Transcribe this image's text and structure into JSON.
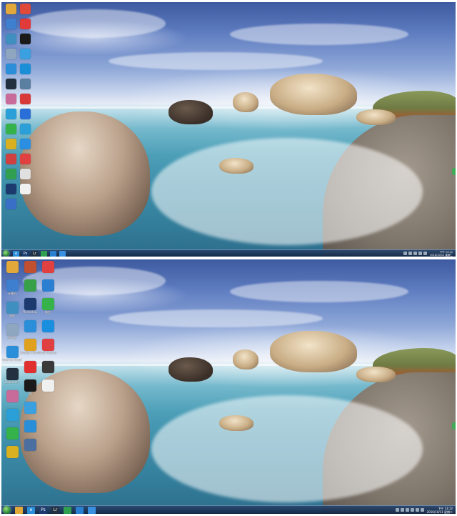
{
  "screens": {
    "top": {
      "icons_col1": [
        {
          "label": "",
          "icon": "folder-icon",
          "color": "#e2a83a"
        },
        {
          "label": "",
          "icon": "computer-icon",
          "color": "#3f7fd0"
        },
        {
          "label": "",
          "icon": "network-icon",
          "color": "#3f8fc0"
        },
        {
          "label": "",
          "icon": "recycle-bin-icon",
          "color": "#8fa6c0"
        },
        {
          "label": "",
          "icon": "ie-icon",
          "color": "#2a8fd8"
        },
        {
          "label": "",
          "icon": "lightroom-icon",
          "color": "#233040"
        },
        {
          "label": "",
          "icon": "app-icon",
          "color": "#c86a9a"
        },
        {
          "label": "",
          "icon": "cloud-icon",
          "color": "#2a9fd8"
        },
        {
          "label": "",
          "icon": "wechat-icon",
          "color": "#35b34a"
        },
        {
          "label": "",
          "icon": "app-icon",
          "color": "#d9b020"
        },
        {
          "label": "",
          "icon": "app-icon",
          "color": "#d04040"
        },
        {
          "label": "",
          "icon": "app-icon",
          "color": "#30a050"
        },
        {
          "label": "",
          "icon": "photoshop-icon",
          "color": "#1c3a6e"
        },
        {
          "label": "",
          "icon": "app-icon",
          "color": "#3a6fc8"
        }
      ],
      "icons_col2": [
        {
          "label": "",
          "icon": "chrome-icon",
          "color": "#e04a3a"
        },
        {
          "label": "",
          "icon": "app-icon",
          "color": "#e03a3a"
        },
        {
          "label": "",
          "icon": "qq-icon",
          "color": "#1a1a1a"
        },
        {
          "label": "",
          "icon": "app-icon",
          "color": "#3aa0e0"
        },
        {
          "label": "",
          "icon": "app-icon",
          "color": "#1a8fd8"
        },
        {
          "label": "",
          "icon": "app-icon",
          "color": "#5a7fa0"
        },
        {
          "label": "",
          "icon": "app-icon",
          "color": "#d83a3a"
        },
        {
          "label": "",
          "icon": "app-icon",
          "color": "#2a6fd8"
        },
        {
          "label": "",
          "icon": "app-icon",
          "color": "#2a9fd8"
        },
        {
          "label": "",
          "icon": "app-icon",
          "color": "#2a8fe0"
        },
        {
          "label": "",
          "icon": "foxit-icon",
          "color": "#e04040"
        },
        {
          "label": "",
          "icon": "app-icon",
          "color": "#e0e0e0"
        },
        {
          "label": "",
          "icon": "app-icon",
          "color": "#f0f0f0"
        }
      ],
      "taskbar": {
        "items": [
          {
            "icon": "ie-icon",
            "glyph": "e",
            "color": "#2a8fd8"
          },
          {
            "icon": "photoshop-icon",
            "glyph": "Ps",
            "color": "#1c3a6e"
          },
          {
            "icon": "lightroom-icon",
            "glyph": "Lr",
            "color": "#233040"
          },
          {
            "icon": "app-icon",
            "glyph": "",
            "color": "#30a050"
          },
          {
            "icon": "app-icon",
            "glyph": "",
            "color": "#2a7fd0"
          },
          {
            "icon": "app-icon",
            "glyph": "",
            "color": "#3a90e0"
          }
        ],
        "clock_time": "下午 13:12",
        "clock_date": "2016/10/11 星期二"
      }
    },
    "bottom": {
      "icons_col1": [
        {
          "label": "",
          "icon": "folder-icon",
          "color": "#e2a83a"
        },
        {
          "label": "计算机",
          "icon": "computer-icon",
          "color": "#3f7fd0"
        },
        {
          "label": "网络",
          "icon": "network-icon",
          "color": "#3f8fc0"
        },
        {
          "label": "回收站",
          "icon": "recycle-bin-icon",
          "color": "#8fa6c0"
        },
        {
          "label": "Internet Explorer",
          "icon": "ie-icon",
          "color": "#2a8fd8"
        },
        {
          "label": "Lightroom",
          "icon": "lightroom-icon",
          "color": "#233040"
        },
        {
          "label": "",
          "icon": "app-icon",
          "color": "#c86a9a"
        },
        {
          "label": "",
          "icon": "cloud-icon",
          "color": "#2a9fd8"
        },
        {
          "label": "",
          "icon": "wechat-icon",
          "color": "#35b34a"
        },
        {
          "label": "",
          "icon": "app-icon",
          "color": "#d9b020"
        }
      ],
      "icons_col2": [
        {
          "label": "",
          "icon": "app-icon",
          "color": "#c05030"
        },
        {
          "label": "",
          "icon": "shield-icon",
          "color": "#38a048"
        },
        {
          "label": "Photoshop",
          "icon": "photoshop-icon",
          "color": "#1c3a6e"
        },
        {
          "label": "",
          "icon": "app-icon",
          "color": "#2a8fd8"
        },
        {
          "label": "Google Chrome",
          "icon": "chrome-icon",
          "color": "#e0a020"
        },
        {
          "label": "",
          "icon": "app-icon",
          "color": "#e03030"
        },
        {
          "label": "QQ",
          "icon": "qq-icon",
          "color": "#1a1a1a"
        },
        {
          "label": "",
          "icon": "app-icon",
          "color": "#3aa0e0"
        },
        {
          "label": "",
          "icon": "app-icon",
          "color": "#2a8fd8"
        },
        {
          "label": "",
          "icon": "app-icon",
          "color": "#4a6fa0"
        }
      ],
      "icons_col3": [
        {
          "label": "",
          "icon": "app-icon",
          "color": "#e04040"
        },
        {
          "label": "",
          "icon": "app-icon",
          "color": "#2a7fd0"
        },
        {
          "label": "微信",
          "icon": "wechat-icon",
          "color": "#35b34a"
        },
        {
          "label": "",
          "icon": "app-icon",
          "color": "#1a8fe0"
        },
        {
          "label": "Foxit Reader",
          "icon": "foxit-icon",
          "color": "#e04040"
        },
        {
          "label": "",
          "icon": "app-icon",
          "color": "#3a3a3a"
        },
        {
          "label": "",
          "icon": "app-icon",
          "color": "#f0f0f0"
        }
      ],
      "taskbar": {
        "items": [
          {
            "icon": "explorer-icon",
            "glyph": "",
            "color": "#e2a83a"
          },
          {
            "icon": "ie-icon",
            "glyph": "e",
            "color": "#2a8fd8"
          },
          {
            "icon": "photoshop-icon",
            "glyph": "Ps",
            "color": "#1c3a6e"
          },
          {
            "icon": "lightroom-icon",
            "glyph": "Lr",
            "color": "#233040"
          },
          {
            "icon": "app-icon",
            "glyph": "",
            "color": "#30a050"
          },
          {
            "icon": "app-icon",
            "glyph": "",
            "color": "#2a7fd0"
          },
          {
            "icon": "app-icon",
            "glyph": "",
            "color": "#3a90e0"
          }
        ],
        "clock_time": "下午 13:12",
        "clock_date": "2016/10/11 星期二"
      }
    }
  }
}
